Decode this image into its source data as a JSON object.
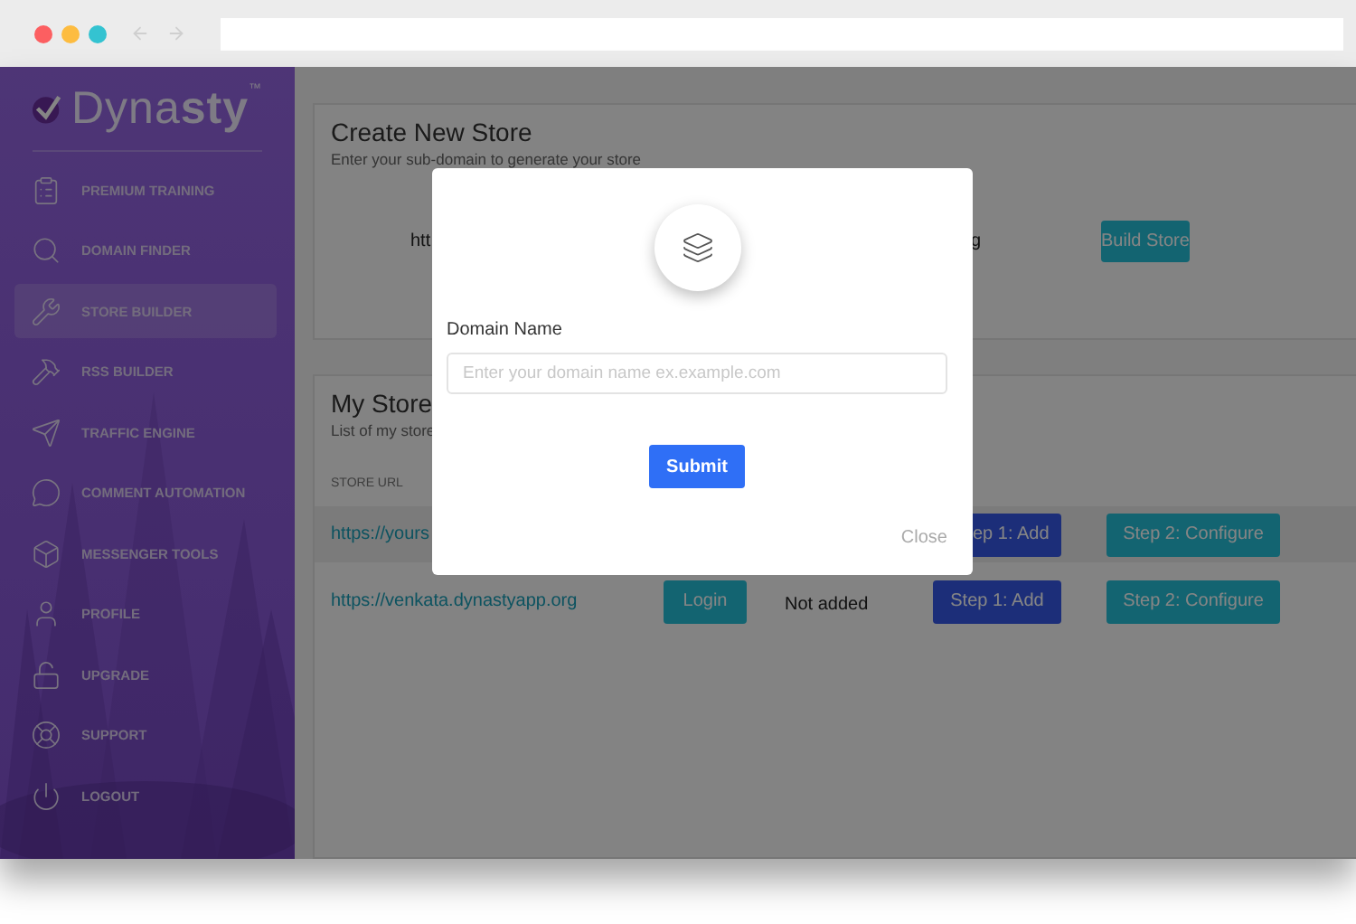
{
  "sidebar": {
    "logo": {
      "light": "Dyna",
      "bold": "sty",
      "mark": "™"
    },
    "items": [
      {
        "label": "PREMIUM TRAINING",
        "selected": false
      },
      {
        "label": "DOMAIN FINDER",
        "selected": false
      },
      {
        "label": "STORE BUILDER",
        "selected": true
      },
      {
        "label": "RSS BUILDER",
        "selected": false
      },
      {
        "label": "TRAFFIC ENGINE",
        "selected": false
      },
      {
        "label": "COMMENT AUTOMATION",
        "selected": false
      },
      {
        "label": "MESSENGER TOOLS",
        "selected": false
      },
      {
        "label": "PROFILE",
        "selected": false
      },
      {
        "label": "UPGRADE",
        "selected": false
      },
      {
        "label": "SUPPORT",
        "selected": false
      },
      {
        "label": "LOGOUT",
        "selected": false
      }
    ]
  },
  "create_store": {
    "title": "Create New Store",
    "subtitle": "Enter your sub-domain to generate your store",
    "prefix": "htt",
    "suffix": "g",
    "button": "Build Store"
  },
  "my_stores": {
    "title": "My Store",
    "subtitle": "List of my store",
    "columns": [
      "STORE URL"
    ],
    "rows": [
      {
        "url": "https://yours",
        "step1": "ep 1: Add",
        "step2": "Step 2: Configure",
        "partial": true
      },
      {
        "url": "https://venkata.dynastyapp.org",
        "login": "Login",
        "status": "Not added",
        "step1": "Step 1: Add",
        "step2": "Step 2: Configure",
        "partial": false
      }
    ]
  },
  "modal": {
    "label": "Domain Name",
    "placeholder": "Enter your domain name ex.example.com",
    "submit": "Submit",
    "close": "Close"
  }
}
